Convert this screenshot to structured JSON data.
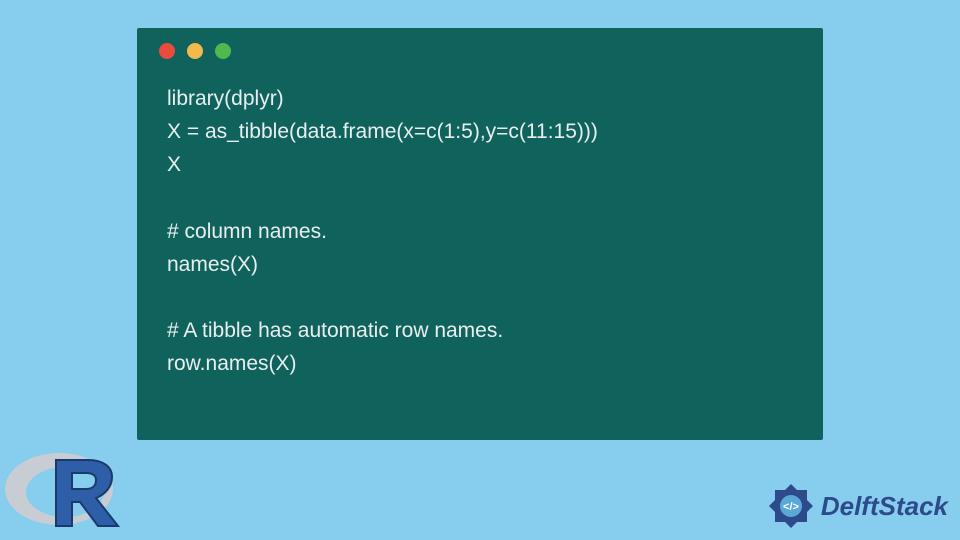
{
  "code": {
    "lines": "library(dplyr)\nX = as_tibble(data.frame(x=c(1:5),y=c(11:15)))\nX\n\n# column names.\nnames(X)\n\n# A tibble has automatic row names.\nrow.names(X)"
  },
  "window": {
    "dots": [
      "red",
      "yellow",
      "green"
    ]
  },
  "brand": {
    "name": "DelftStack",
    "language_logo": "R"
  },
  "colors": {
    "page_bg": "#87cdee",
    "code_bg": "#10635c",
    "code_fg": "#e8eef0",
    "brand_blue": "#2d4a8a"
  }
}
